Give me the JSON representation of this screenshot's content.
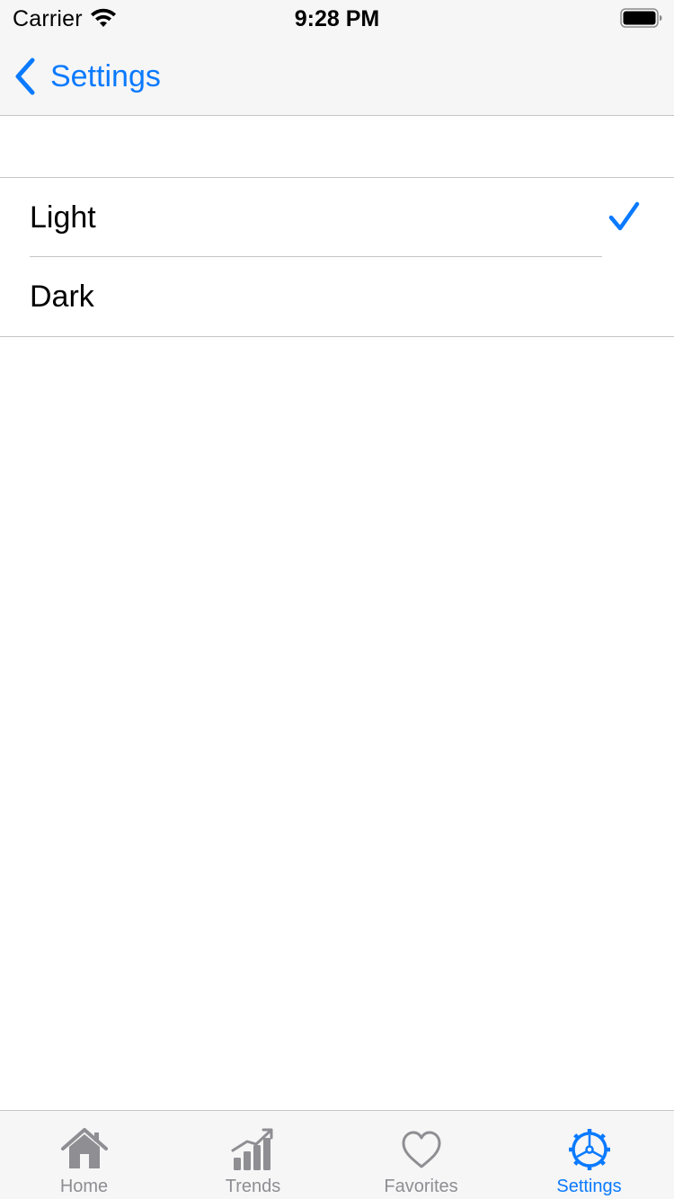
{
  "status_bar": {
    "carrier": "Carrier",
    "time": "9:28 PM"
  },
  "nav": {
    "back_label": "Settings"
  },
  "options": [
    {
      "label": "Light",
      "selected": true
    },
    {
      "label": "Dark",
      "selected": false
    }
  ],
  "tabs": [
    {
      "label": "Home",
      "icon": "house-icon",
      "active": false
    },
    {
      "label": "Trends",
      "icon": "chart-bars-icon",
      "active": false
    },
    {
      "label": "Favorites",
      "icon": "heart-icon",
      "active": false
    },
    {
      "label": "Settings",
      "icon": "gear-icon",
      "active": true
    }
  ],
  "colors": {
    "accent": "#0a7aff",
    "inactive": "#8e8e93",
    "bar_background": "#f6f6f6",
    "separator": "#c6c6c8"
  }
}
